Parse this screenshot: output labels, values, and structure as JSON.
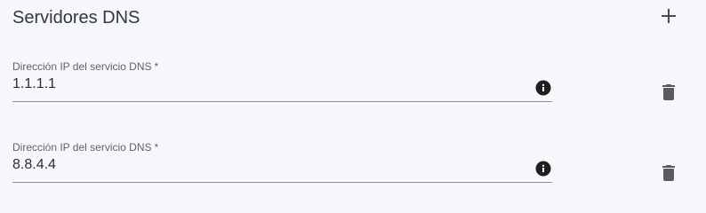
{
  "section": {
    "title": "Servidores DNS",
    "add_icon": "plus-icon"
  },
  "dns_servers": [
    {
      "label": "Dirección IP del servicio DNS",
      "required_mark": "*",
      "value": "1.1.1.1",
      "info_icon": "info-icon",
      "delete_icon": "trash-icon"
    },
    {
      "label": "Dirección IP del servicio DNS",
      "required_mark": "*",
      "value": "8.8.4.4",
      "info_icon": "info-icon",
      "delete_icon": "trash-icon"
    }
  ],
  "colors": {
    "background": "#f6f7fb",
    "icon": "#1f1f1f",
    "delete_icon": "#5a5c60",
    "underline": "#8a8d93"
  }
}
